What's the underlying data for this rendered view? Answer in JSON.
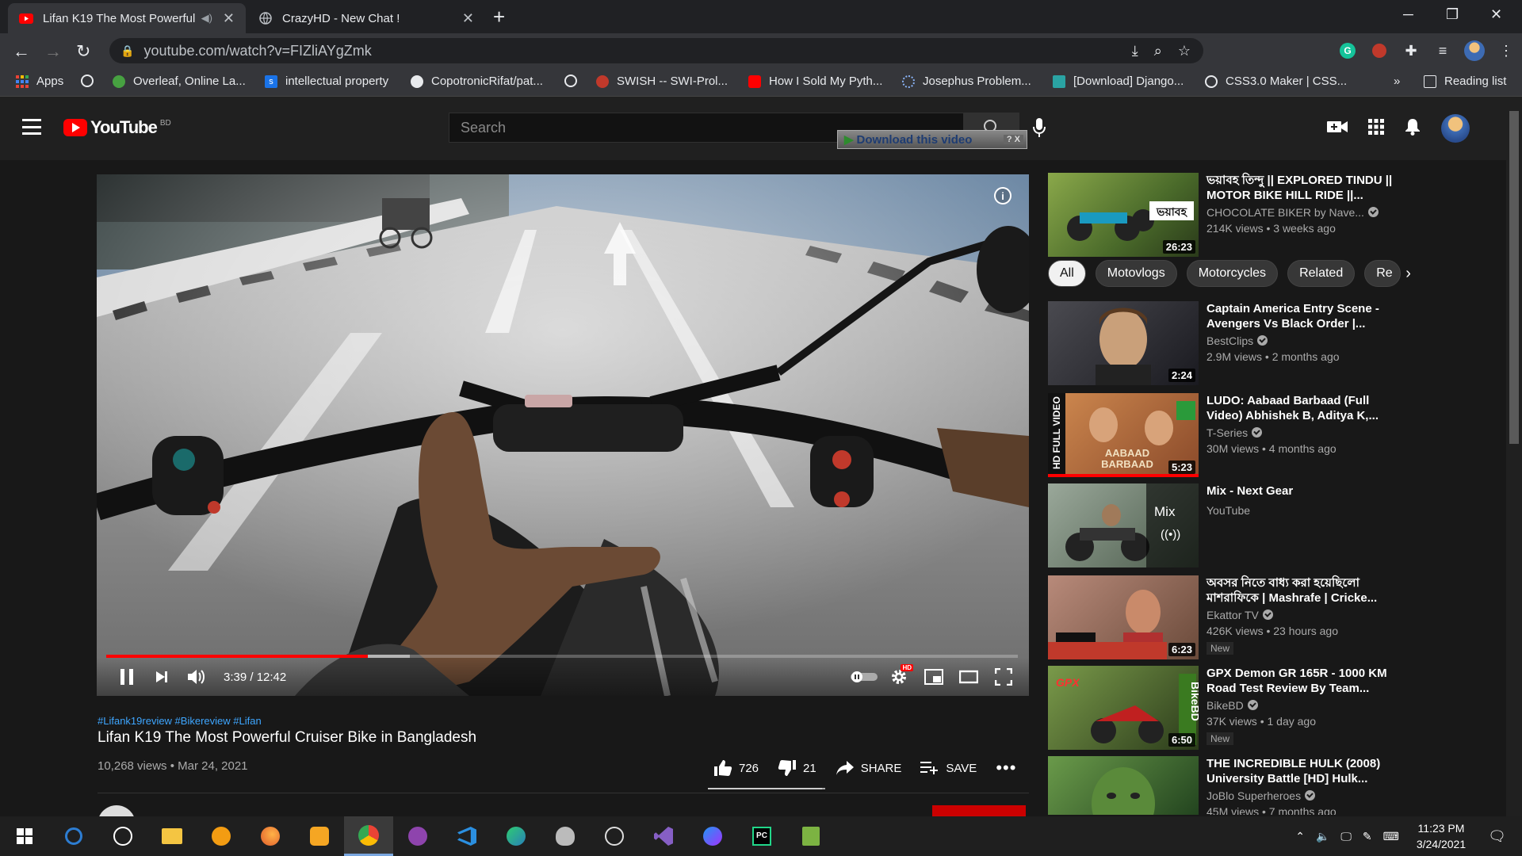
{
  "browser": {
    "tabs": [
      {
        "title": "Lifan K19 The Most Powerful",
        "active": true
      },
      {
        "title": "CrazyHD - New Chat !",
        "active": false
      }
    ],
    "url": "youtube.com/watch?v=FIZliAYgZmk",
    "bookmarks": [
      {
        "label": "Apps",
        "icon": "apps-grid-icon"
      },
      {
        "label": "",
        "icon": "globe-icon"
      },
      {
        "label": "Overleaf, Online La...",
        "icon": "overleaf-icon"
      },
      {
        "label": "intellectual property",
        "icon": "s-favicon-icon"
      },
      {
        "label": "CopotronicRifat/pat...",
        "icon": "github-icon"
      },
      {
        "label": "",
        "icon": "globe-icon"
      },
      {
        "label": "SWISH -- SWI-Prol...",
        "icon": "swish-icon"
      },
      {
        "label": "How I Sold My Pyth...",
        "icon": "youtube-icon"
      },
      {
        "label": "Josephus Problem...",
        "icon": "loading-icon"
      },
      {
        "label": "[Download] Django...",
        "icon": "site-icon"
      },
      {
        "label": "CSS3.0 Maker | CSS...",
        "icon": "globe-icon"
      }
    ],
    "reading_list": "Reading list",
    "more": "»"
  },
  "youtube": {
    "logo_text": "YouTube",
    "country_code": "BD",
    "search_placeholder": "Search",
    "download_overlay": "Download this video",
    "download_overlay_help": "? X"
  },
  "video": {
    "current_time": "3:39",
    "duration": "12:42",
    "time_display": "3:39 / 12:42",
    "played_fraction": 0.287,
    "buffered_fraction": 0.333,
    "hashtags": "#Lifank19review #Bikereview #Lifan",
    "title": "Lifan K19 The Most Powerful Cruiser Bike in Bangladesh",
    "meta": "10,268 views • Mar 24, 2021",
    "likes": "726",
    "dislikes": "21",
    "share": "SHARE",
    "save": "SAVE",
    "hd_badge": "HD"
  },
  "sidebar": {
    "chips": [
      "All",
      "Motovlogs",
      "Motorcycles",
      "Related",
      "Re"
    ],
    "items": [
      {
        "title": "ভয়াবহ তিন্দু || EXPLORED TINDU || MOTOR BIKE HILL RIDE ||...",
        "channel": "CHOCOLATE BIKER by Nave...",
        "verified": true,
        "stats": "214K views • 3 weeks ago",
        "duration": "26:23",
        "badge": "",
        "thumb_color": "#5a7a3a"
      },
      {
        "title": "Captain America Entry Scene - Avengers Vs Black Order |...",
        "channel": "BestClips",
        "verified": true,
        "stats": "2.9M views • 2 months ago",
        "duration": "2:24",
        "badge": "",
        "thumb_color": "#3a3a40"
      },
      {
        "title": "LUDO: Aabaad Barbaad (Full Video) Abhishek B, Aditya K,...",
        "channel": "T-Series",
        "verified": true,
        "stats": "30M views • 4 months ago",
        "duration": "5:23",
        "badge": "",
        "thumb_color": "#b86a3a"
      },
      {
        "title": "Mix - Next Gear",
        "channel": "YouTube",
        "verified": false,
        "stats": "",
        "duration": "",
        "badge": "",
        "thumb_color": "#6a7a6a",
        "mix_label": "Mix"
      },
      {
        "title": "অবসর নিতে বাধ্য করা হয়েছিলো মাশরাফিকে | Mashrafe | Cricke...",
        "channel": "Ekattor TV",
        "verified": true,
        "stats": "426K views • 23 hours ago",
        "duration": "6:23",
        "badge": "New",
        "thumb_color": "#8a5a4a"
      },
      {
        "title": "GPX Demon GR 165R - 1000 KM Road Test Review By Team...",
        "channel": "BikeBD",
        "verified": true,
        "stats": "37K views • 1 day ago",
        "duration": "6:50",
        "badge": "New",
        "thumb_color": "#4a6a2a"
      },
      {
        "title": "THE INCREDIBLE HULK (2008) University Battle [HD] Hulk...",
        "channel": "JoBlo Superheroes",
        "verified": true,
        "stats": "45M views • 7 months ago",
        "duration": "",
        "badge": "",
        "thumb_color": "#4a6a3a"
      }
    ]
  },
  "taskbar": {
    "time": "11:23 PM",
    "date": "3/24/2021"
  },
  "colors": {
    "accent_red": "#ff0000",
    "link_blue": "#3ea6ff"
  }
}
